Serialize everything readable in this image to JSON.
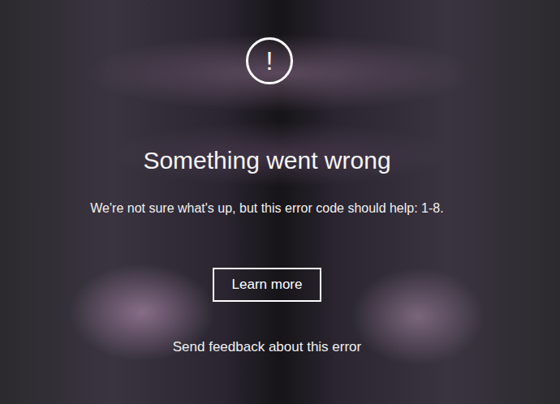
{
  "dialog": {
    "icon": "!",
    "title": "Something went wrong",
    "message": "We're not sure what's up, but this error code should help: 1-8.",
    "button": "Learn more",
    "link": "Send feedback about this error"
  }
}
